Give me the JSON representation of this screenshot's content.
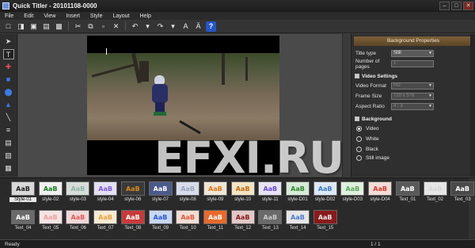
{
  "window": {
    "title": "Quick Titler - 20101108-0000"
  },
  "menu": [
    "File",
    "Edit",
    "View",
    "Insert",
    "Style",
    "Layout",
    "Help"
  ],
  "toolbar": {
    "help_label": "?"
  },
  "panel": {
    "header": "Background Properties",
    "title_type_label": "Title type",
    "title_type_value": "Still",
    "pages_label": "Number of pages",
    "pages_value": "1",
    "video_settings_label": "Video Settings",
    "video_format_label": "Video Format",
    "video_format_value": "HD",
    "frame_size_label": "Frame Size",
    "frame_size_value": "720 x 576",
    "aspect_ratio_label": "Aspect Ratio",
    "aspect_ratio_value": "4 : 3",
    "background_label": "Background",
    "background_options": [
      "Video",
      "White",
      "Black",
      "Still image"
    ],
    "background_selected": "Video"
  },
  "watermark": "EFXI.RU",
  "styles": [
    {
      "label": "Style-01",
      "text": "AaB",
      "color": "#222222",
      "bg": "#d8d8d8"
    },
    {
      "label": "style-02",
      "text": "AaB",
      "color": "#1d7a22",
      "bg": "#f0f0f0"
    },
    {
      "label": "style-03",
      "text": "AaB",
      "color": "#8fb5a8",
      "bg": "#d6dcd8"
    },
    {
      "label": "style-04",
      "text": "AaB",
      "color": "#7a5bd8",
      "bg": "#e4e0f2"
    },
    {
      "label": "style-06",
      "text": "AaB",
      "color": "#d88a1a",
      "bg": "#3a3a3a"
    },
    {
      "label": "style-07",
      "text": "AaB",
      "color": "#ffffff",
      "bg": "#4a5a8a"
    },
    {
      "label": "style-08",
      "text": "AaB",
      "color": "#9aa6c0",
      "bg": "#d8dcea"
    },
    {
      "label": "style-09",
      "text": "AaB",
      "color": "#e07818",
      "bg": "#efe6d8"
    },
    {
      "label": "style-10",
      "text": "AaB",
      "color": "#c06a12",
      "bg": "#f2e4c4"
    },
    {
      "label": "style-11",
      "text": "AaB",
      "color": "#6a4ad0",
      "bg": "#e8e4f4"
    },
    {
      "label": "style-D01",
      "text": "AaB",
      "color": "#2a8a2a",
      "bg": "#d8ead8"
    },
    {
      "label": "style-D02",
      "text": "AaB",
      "color": "#3a7ac8",
      "bg": "#dde8f4"
    },
    {
      "label": "style-D03",
      "text": "AaB",
      "color": "#5aa85a",
      "bg": "#e0efe0"
    },
    {
      "label": "style-D04",
      "text": "AaB",
      "color": "#d83a2a",
      "bg": "#f2dcd8"
    },
    {
      "label": "Text_01",
      "text": "AaB",
      "color": "#ffffff",
      "bg": "#5a5a5a"
    },
    {
      "label": "Text_02",
      "text": "AaB",
      "color": "#d8d8d8",
      "bg": "#e6e6e6"
    },
    {
      "label": "Text_03",
      "text": "AaB",
      "color": "#ffffff",
      "bg": "#4a4a4a"
    },
    {
      "label": "Text_04",
      "text": "AaB",
      "color": "#ffffff",
      "bg": "#6a6a6a"
    },
    {
      "label": "Text_05",
      "text": "AaB",
      "color": "#f0a0a0",
      "bg": "#f4e4e4"
    },
    {
      "label": "Text_06",
      "text": "AaB",
      "color": "#e05a5a",
      "bg": "#f0d8d8"
    },
    {
      "label": "Text_07",
      "text": "AaB",
      "color": "#e8a43a",
      "bg": "#f6ead4"
    },
    {
      "label": "Text_08",
      "text": "AaB",
      "color": "#ffffff",
      "bg": "#c83a3a"
    },
    {
      "label": "Text_09",
      "text": "AaB",
      "color": "#2a5ad8",
      "bg": "#c8d8f2"
    },
    {
      "label": "Text_10",
      "text": "AaB",
      "color": "#e05a3a",
      "bg": "#f2dcd4"
    },
    {
      "label": "Text_11",
      "text": "AaB",
      "color": "#ffffff",
      "bg": "#e86a2a"
    },
    {
      "label": "Text_12",
      "text": "AaB",
      "color": "#8a1a1a",
      "bg": "#e2c8c8"
    },
    {
      "label": "Text_13",
      "text": "AaB",
      "color": "#c8c8c8",
      "bg": "#6a6a6a"
    },
    {
      "label": "Text_14",
      "text": "AaB",
      "color": "#4a7ad8",
      "bg": "#e6e6e6"
    },
    {
      "label": "Text_15",
      "text": "AaB",
      "color": "#e8e8e8",
      "bg": "#8a1a1a"
    }
  ],
  "status": {
    "left": "Ready",
    "page": "1 / 1"
  }
}
